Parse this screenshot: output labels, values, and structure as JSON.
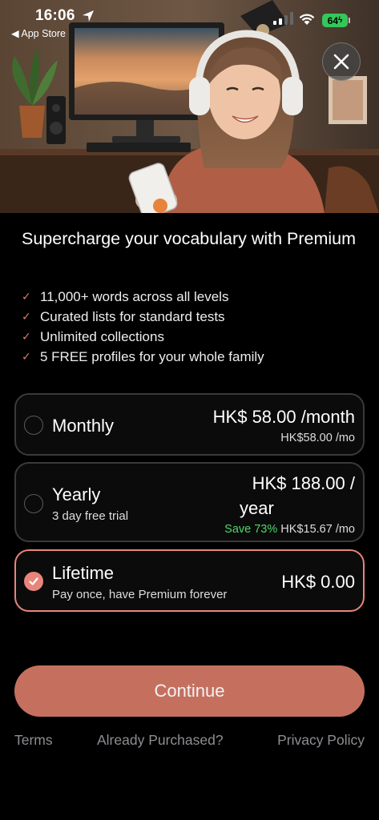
{
  "status_bar": {
    "time": "16:06",
    "back_app": "◀ App Store",
    "battery": "64"
  },
  "hero": {
    "image": "woman-with-headphones-smiling-at-phone",
    "close_icon": "close-icon"
  },
  "headline": "Supercharge your vocabulary with Premium",
  "features": [
    "11,000+ words across all levels",
    "Curated lists for standard tests",
    "Unlimited collections",
    "5 FREE profiles for your whole family"
  ],
  "plans": {
    "monthly": {
      "name": "Monthly",
      "price": "HK$ 58.00 /month",
      "per_month": "HK$58.00 /mo",
      "selected": false
    },
    "yearly": {
      "name": "Yearly",
      "subtitle": "3 day free trial",
      "price_line1": "HK$ 188.00 /",
      "price_line2": "year",
      "save": "Save 73%",
      "per_month": "HK$15.67 /mo",
      "selected": false
    },
    "lifetime": {
      "name": "Lifetime",
      "subtitle": "Pay once, have Premium forever",
      "price": "HK$ 0.00",
      "selected": true
    }
  },
  "cta": {
    "label": "Continue"
  },
  "footer": {
    "terms": "Terms",
    "restore": "Already Purchased?",
    "privacy": "Privacy Policy"
  },
  "colors": {
    "accent": "#e8857b",
    "button": "#c5705f",
    "save_green": "#4cd964",
    "background": "#000000"
  }
}
